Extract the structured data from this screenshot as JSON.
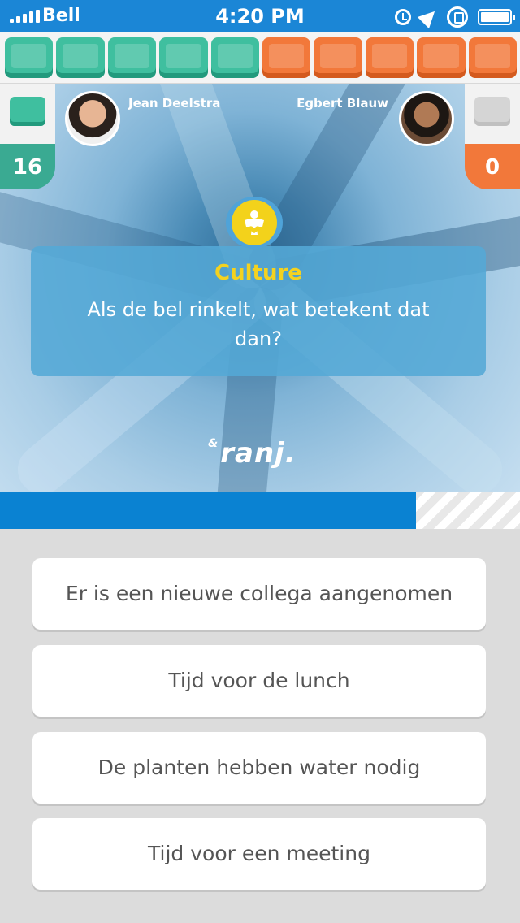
{
  "status_bar": {
    "carrier": "Bell",
    "time": "4:20 PM",
    "icons": [
      "alarm-icon",
      "location-icon",
      "rotation-lock-icon",
      "battery-icon"
    ]
  },
  "score_gems": [
    "teal",
    "teal",
    "teal",
    "teal",
    "teal",
    "orange",
    "orange",
    "orange",
    "orange",
    "orange"
  ],
  "players": {
    "left": {
      "name": "Jean Deelstra",
      "score": "16",
      "color": "#3aaa92"
    },
    "right": {
      "name": "Egbert Blauw",
      "score": "0",
      "color": "#f2783a"
    }
  },
  "question": {
    "category": "Culture",
    "text": "Als de bel rinkelt, wat betekent dat dan?",
    "category_color": "#f4d21f"
  },
  "brand": {
    "amp": "&",
    "name": "ranj."
  },
  "timer": {
    "progress": 0.8
  },
  "answers": [
    "Er is een nieuwe collega aangenomen",
    "Tijd voor de lunch",
    "De planten hebben water nodig",
    "Tijd voor een meeting"
  ]
}
